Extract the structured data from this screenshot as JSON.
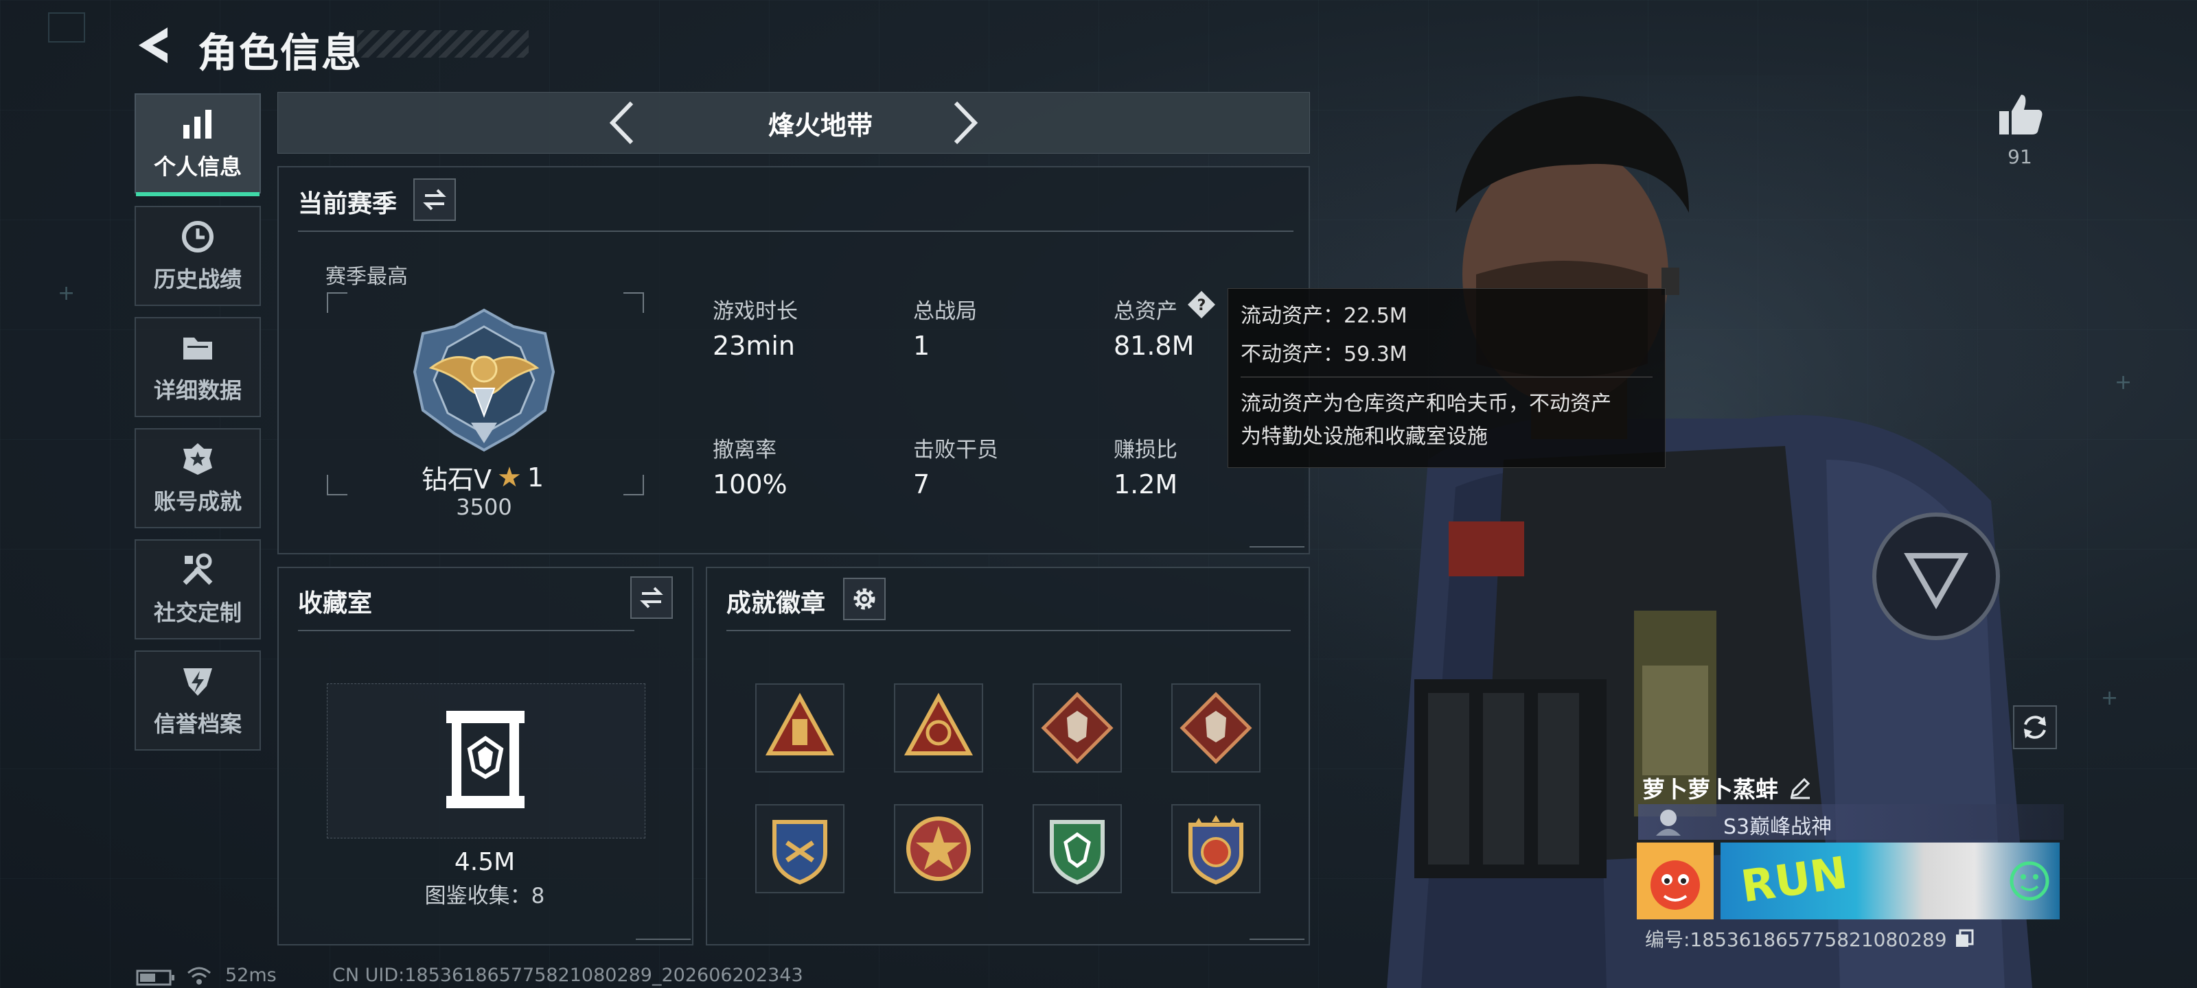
{
  "header": {
    "title": "角色信息"
  },
  "sidebar": {
    "items": [
      {
        "label": "个人信息",
        "icon": "bar-chart-icon",
        "active": true
      },
      {
        "label": "历史战绩",
        "icon": "history-clock-icon",
        "active": false
      },
      {
        "label": "详细数据",
        "icon": "folder-icon",
        "active": false
      },
      {
        "label": "账号成就",
        "icon": "achievement-icon",
        "active": false
      },
      {
        "label": "社交定制",
        "icon": "wrench-icon",
        "active": false
      },
      {
        "label": "信誉档案",
        "icon": "shield-flash-icon",
        "active": false
      }
    ]
  },
  "mode": {
    "name": "烽火地带"
  },
  "season": {
    "title": "当前赛季",
    "best_label": "赛季最高",
    "rank": "钻石V",
    "stars": "1",
    "score": "3500",
    "stats": [
      {
        "label": "游戏时长",
        "value": "23min"
      },
      {
        "label": "总战局",
        "value": "1"
      },
      {
        "label": "总资产",
        "value": "81.8M"
      },
      {
        "label": "撤离率",
        "value": "100%"
      },
      {
        "label": "击败干员",
        "value": "7"
      },
      {
        "label": "赚损比",
        "value": "1.2M"
      }
    ]
  },
  "tooltip": {
    "liquid": "流动资产：22.5M",
    "fixed": "不动资产：59.3M",
    "desc_line1": "流动资产为仓库资产和哈夫币，不动资产",
    "desc_line2": "为特勤处设施和收藏室设施"
  },
  "collection": {
    "title": "收藏室",
    "value": "4.5M",
    "count": "图鉴收集：8"
  },
  "achievements": {
    "title": "成就徽章",
    "badge_count": 8
  },
  "profile": {
    "likes": "91",
    "name": "萝卜萝卜蒸蚌",
    "title": "S3巅峰战神",
    "card_text": "RUN",
    "id_label": "编号:185361865775821080289"
  },
  "footer": {
    "ping": "52ms",
    "uid": "CN UID:185361865775821080289_202606202343"
  },
  "colors": {
    "accent": "#3fd9a8",
    "panel_border": "#3a454e",
    "gold": "#d9a54a"
  }
}
